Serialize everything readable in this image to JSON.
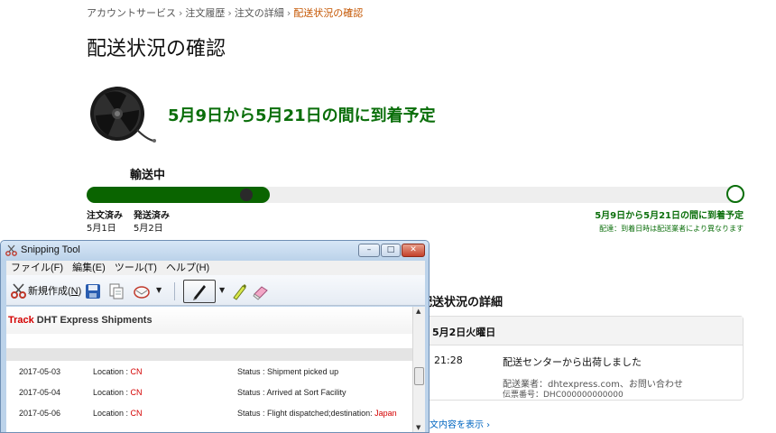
{
  "breadcrumb": {
    "items": [
      "アカウントサービス",
      "注文履歴",
      "注文の詳細"
    ],
    "current": "配送状況の確認",
    "separator": "›"
  },
  "page_title": "配送状況の確認",
  "delivery_estimate": "5月9日から5月21日の間に到着予定",
  "shipping_status": "輸送中",
  "progress": {
    "fraction": 0.28,
    "steps": [
      {
        "label": "注文済み",
        "date": "5月1日"
      },
      {
        "label": "発送済み",
        "date": "5月2日"
      }
    ],
    "eta_label": "5月9日から5月21日の間に到着予定",
    "eta_sub": "配達：到着日時は配送業者により異なります"
  },
  "details": {
    "title": "配送状況の詳細",
    "date_header": "5月2日火曜日",
    "time": "21:28",
    "event": "配送センターから出荷しました",
    "carrier": "配送業者：dhtexpress.com、お問い合わせ",
    "tracking": "伝票番号：DHC000000000000",
    "show_order": "注文内容を表示 ›"
  },
  "snipping_tool": {
    "title": "Snipping Tool",
    "buttons": {
      "minimize": "–",
      "maximize": "□",
      "close": "✕"
    },
    "menus": [
      "ファイル(F)",
      "編集(E)",
      "ツール(T)",
      "ヘルプ(H)"
    ],
    "new_label_pre": "新規作成(",
    "new_label_key": "N",
    "new_label_post": ")",
    "icons": [
      "scissors-icon",
      "save-icon",
      "copy-icon",
      "send-snip-icon",
      "pen-icon",
      "highlighter-icon",
      "eraser-icon"
    ]
  },
  "tracking_panel": {
    "heading_red": "Track",
    "heading_rest": " DHT Express Shipments",
    "rows": [
      {
        "date": "2017-05-03",
        "location_label": "Location : ",
        "location": "CN",
        "status_label": "Status : ",
        "status": "Shipment picked up",
        "status_extra": ""
      },
      {
        "date": "2017-05-04",
        "location_label": "Location : ",
        "location": "CN",
        "status_label": "Status : ",
        "status": "Arrived at Sort Facility",
        "status_extra": ""
      },
      {
        "date": "2017-05-06",
        "location_label": "Location : ",
        "location": "CN",
        "status_label": "Status : ",
        "status": "Flight dispatched;destination: ",
        "status_extra": "Japan"
      }
    ]
  },
  "colors": {
    "accent_green": "#0a6e0a",
    "progress_green": "#0a6400",
    "breadcrumb_current": "#c45500",
    "link_blue": "#0066c0",
    "tracking_red": "#d40000"
  }
}
